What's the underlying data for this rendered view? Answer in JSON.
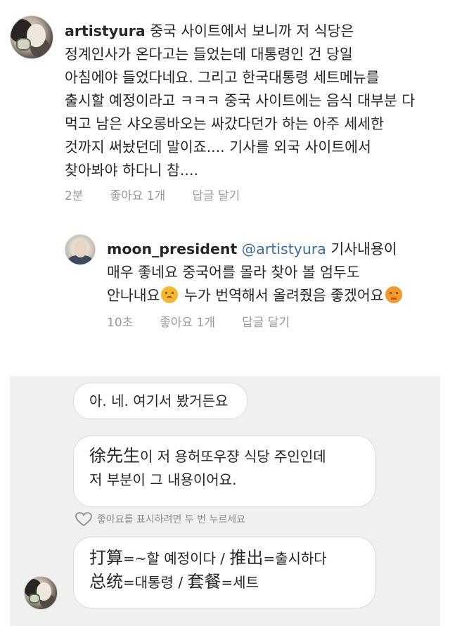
{
  "comment1": {
    "username": "artistyura",
    "lines": [
      " 중국 사이트에서 보니까 저 식당은",
      "정계인사가 온다고는 들었는데 대통령인 건 당일",
      "아침에야 들었다네요. 그리고 한국대통령 세트메뉴를",
      "출시할 예정이라고 ㅋㅋㅋ 중국 사이트에는 음식 대부분 다",
      "먹고 남은 샤오롱바오는 싸갔다던가 하는 아주 세세한",
      "것까지 써놨던데 말이죠.... 기사를 외국 사이트에서",
      "찾아봐야 하다니 참...."
    ],
    "time": "2분",
    "likes": "좋아요 1개",
    "reply": "답글 달기"
  },
  "comment2": {
    "username": "moon_president",
    "mention": "@artistyura",
    "line1": " 기사내용이",
    "line2": "매우 좋네요 중국어를 몰라 찾아 볼 엄두도",
    "line3a": "안나내요",
    "line3b": " 누가 번역해서 올려줬음 좋겠어요",
    "time": "10초",
    "likes": "좋아요 1개",
    "reply": "답글 달기"
  },
  "dm": {
    "msg1": "아. 네. 여기서 봤거든요",
    "msg2_cjk": "徐先生",
    "msg2_line1": "이 저 용허또우쟝 식당 주인인데",
    "msg2_line2": "저 부분이 그 내용이어요.",
    "like_hint": "좋아요를 표시하려면 두 번 누르세요",
    "msg3_l1_a": "打算",
    "msg3_l1_b": "=~할 예정이다 / ",
    "msg3_l1_c": "推出",
    "msg3_l1_d": "=출시하다",
    "msg3_l2_a": "总统",
    "msg3_l2_b": "=대통령 / ",
    "msg3_l2_c": "套餐",
    "msg3_l2_d": "=세트"
  },
  "icons": {
    "heart": "heart-outline-icon",
    "emoji_frown": "frowning-face-icon",
    "emoji_cry": "loudly-crying-face-icon"
  }
}
